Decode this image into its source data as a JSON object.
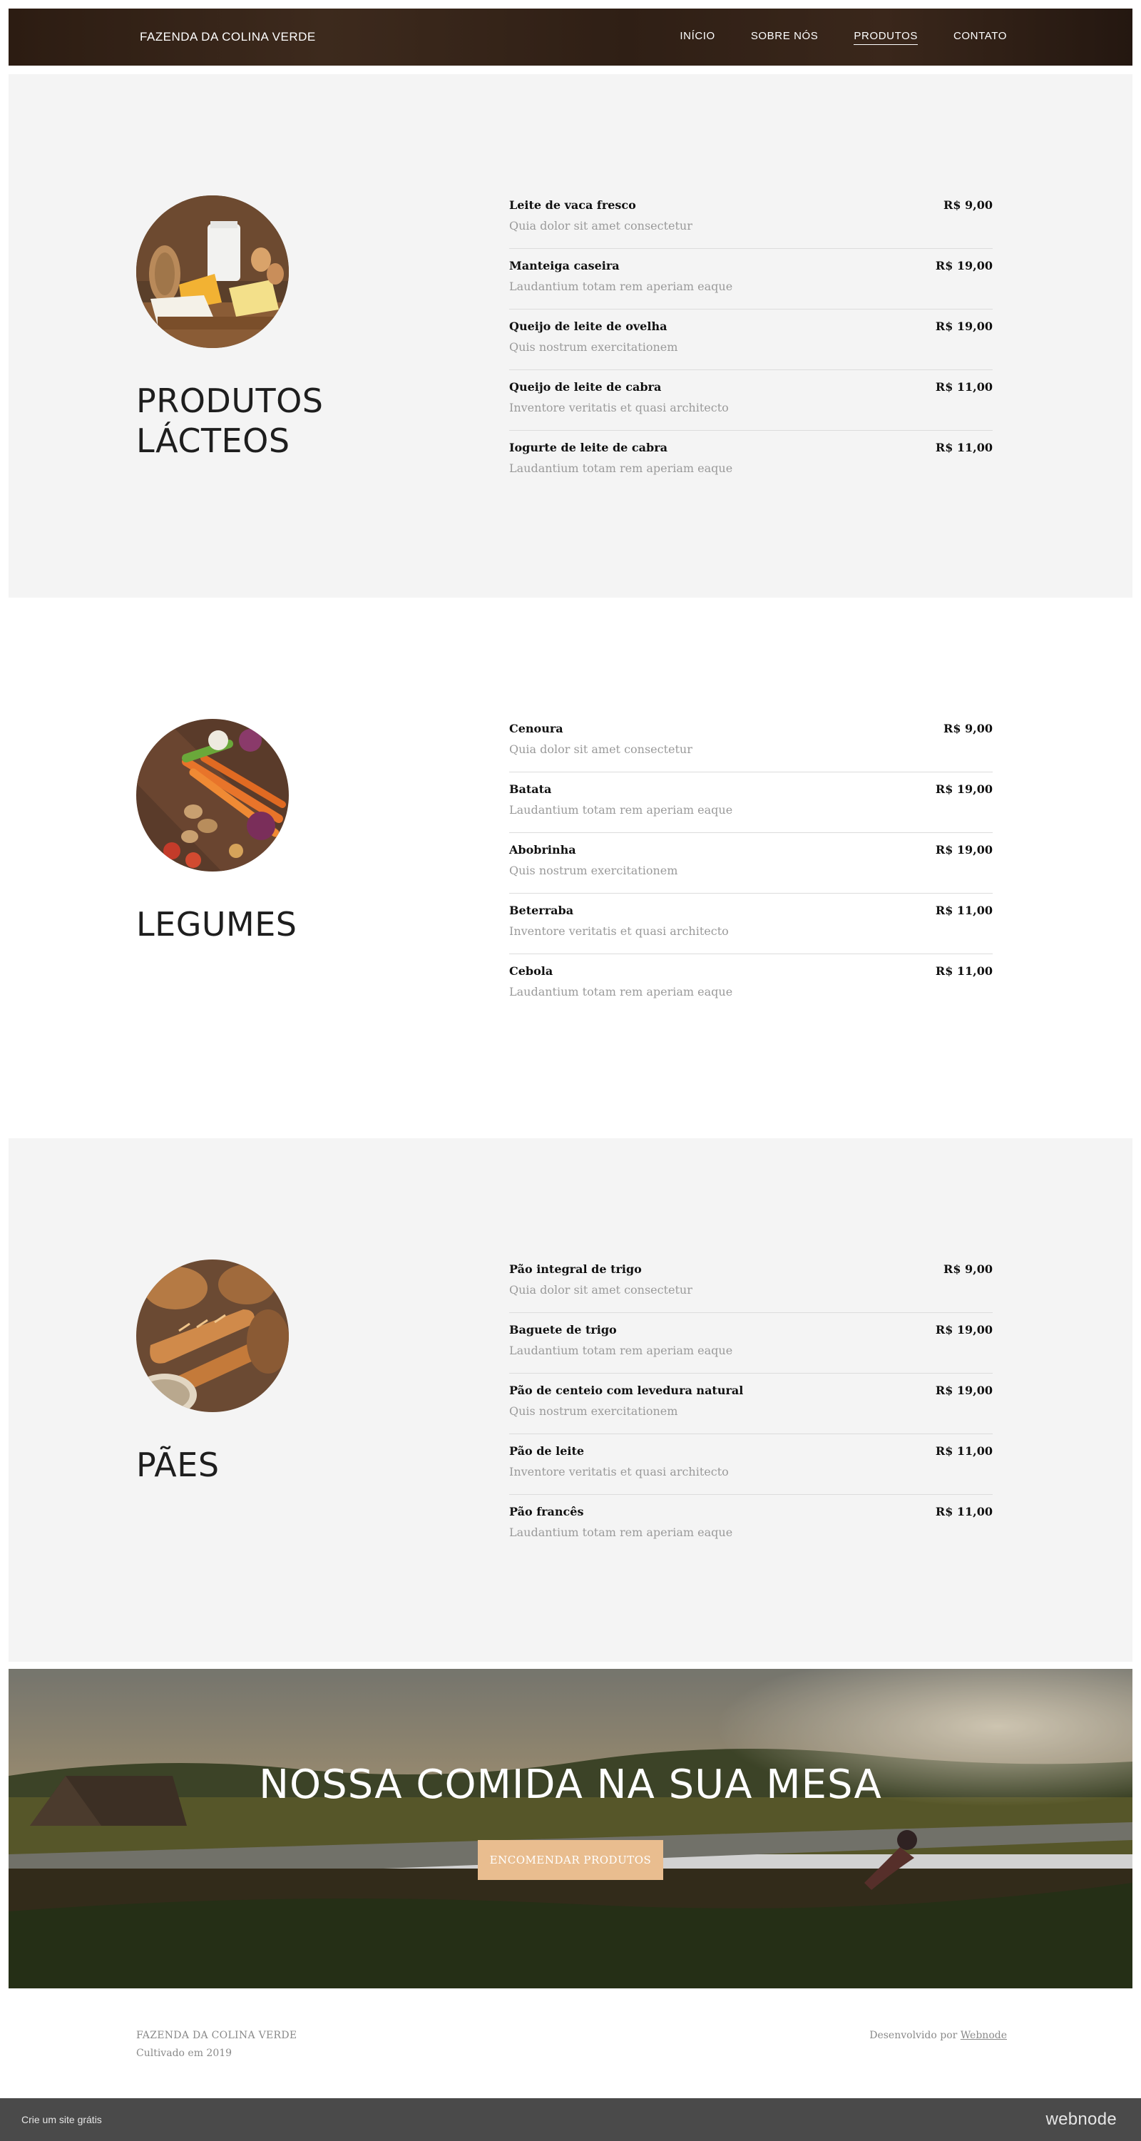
{
  "header": {
    "brand": "FAZENDA DA COLINA VERDE",
    "nav": [
      "INÍCIO",
      "SOBRE NÓS",
      "PRODUTOS",
      "CONTATO"
    ],
    "active_nav": "PRODUTOS"
  },
  "sections": [
    {
      "title": "PRODUTOS LÁCTEOS",
      "items": [
        {
          "name": "Leite de vaca fresco",
          "desc": "Quia dolor sit amet consectetur",
          "price": "R$ 9,00"
        },
        {
          "name": "Manteiga caseira",
          "desc": "Laudantium totam rem aperiam eaque",
          "price": "R$ 19,00"
        },
        {
          "name": "Queijo de leite de ovelha",
          "desc": "Quis nostrum exercitationem",
          "price": "R$ 19,00"
        },
        {
          "name": "Queijo de leite de cabra",
          "desc": "Inventore veritatis et quasi architecto",
          "price": "R$ 11,00"
        },
        {
          "name": "Iogurte de leite de cabra",
          "desc": "Laudantium totam rem aperiam eaque",
          "price": "R$ 11,00"
        }
      ]
    },
    {
      "title": "LEGUMES",
      "items": [
        {
          "name": "Cenoura",
          "desc": "Quia dolor sit amet consectetur",
          "price": "R$ 9,00"
        },
        {
          "name": "Batata",
          "desc": "Laudantium totam rem aperiam eaque",
          "price": "R$ 19,00"
        },
        {
          "name": "Abobrinha",
          "desc": "Quis nostrum exercitationem",
          "price": "R$ 19,00"
        },
        {
          "name": "Beterraba",
          "desc": "Inventore veritatis et quasi architecto",
          "price": "R$ 11,00"
        },
        {
          "name": "Cebola",
          "desc": "Laudantium totam rem aperiam eaque",
          "price": "R$ 11,00"
        }
      ]
    },
    {
      "title": "PÃES",
      "items": [
        {
          "name": "Pão integral de trigo",
          "desc": "Quia dolor sit amet consectetur",
          "price": "R$ 9,00"
        },
        {
          "name": "Baguete de trigo",
          "desc": "Laudantium totam rem aperiam eaque",
          "price": "R$ 19,00"
        },
        {
          "name": "Pão de centeio com levedura natural",
          "desc": "Quis nostrum exercitationem",
          "price": "R$ 19,00"
        },
        {
          "name": "Pão de leite",
          "desc": "Inventore veritatis et quasi architecto",
          "price": "R$ 11,00"
        },
        {
          "name": "Pão francês",
          "desc": "Laudantium totam rem aperiam eaque",
          "price": "R$ 11,00"
        }
      ]
    }
  ],
  "banner": {
    "title": "NOSSA COMIDA NA SUA MESA",
    "button": "ENCOMENDAR PRODUTOS"
  },
  "footer": {
    "brand": "FAZENDA DA COLINA VERDE",
    "sub": "Cultivado em 2019",
    "credit_prefix": "Desenvolvido por",
    "credit_link": "Webnode"
  },
  "bottom_bar": {
    "left": "Crie um site grátis",
    "logo": "webnode"
  },
  "colors": {
    "header_bg": "#2f1f15",
    "section_gray": "#f4f4f4",
    "button_bg": "#e9bd8f",
    "bottom_bar_bg": "#4a4a4a"
  }
}
